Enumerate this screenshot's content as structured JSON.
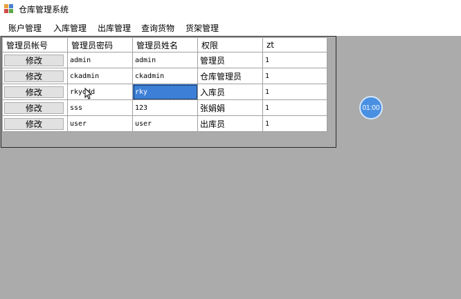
{
  "window": {
    "title": "仓库管理系统",
    "icon": "app-window-icon"
  },
  "menu": [
    {
      "label": "账户管理"
    },
    {
      "label": "入库管理"
    },
    {
      "label": "出库管理"
    },
    {
      "label": "查询货物"
    },
    {
      "label": "货架管理"
    }
  ],
  "grid": {
    "columns": [
      "管理员帐号",
      "管理员密码",
      "管理员姓名",
      "权限",
      "zt"
    ],
    "button_label": "修改",
    "rows": [
      {
        "password": "admin",
        "name": "admin",
        "role": "管理员",
        "zt": "1"
      },
      {
        "password": "ckadmin",
        "name": "ckadmin",
        "role": "仓库管理员",
        "zt": "1"
      },
      {
        "password": "rkyddd",
        "name": "rky",
        "role": "入库员",
        "zt": "1"
      },
      {
        "password": "sss",
        "name": "123",
        "role": "张娟娟",
        "zt": "1"
      },
      {
        "password": "user",
        "name": "user",
        "role": "出库员",
        "zt": "1"
      }
    ],
    "selected_cell": "row 3, 管理员姓名"
  },
  "timer": {
    "label": "01:00"
  },
  "colors": {
    "background": "#ababab",
    "selection": "#3d7fd6",
    "timer": "#4a90e2"
  }
}
